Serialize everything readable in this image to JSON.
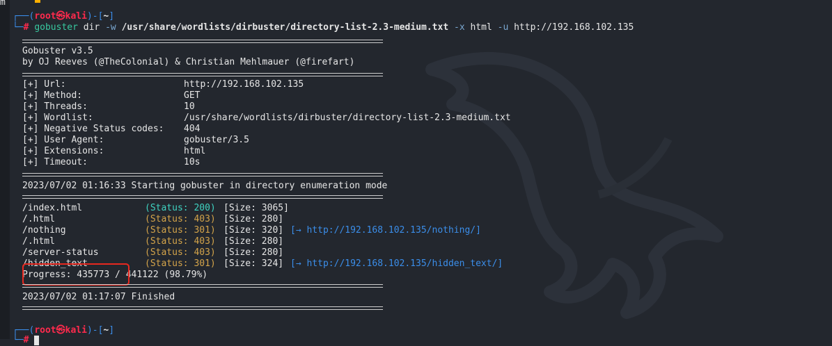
{
  "prompt": {
    "open": "┌──(",
    "user": "root㉿kali",
    "mid": ")-[",
    "dir": "~",
    "close": "]",
    "hash_prefix": "└─",
    "hash": "#"
  },
  "command": {
    "bin": "gobuster",
    "sub": "dir",
    "flag_w": "-w",
    "wordlist": "/usr/share/wordlists/dirbuster/directory-list-2.3-medium.txt",
    "flag_x": "-x",
    "ext": "html",
    "flag_u": "-u",
    "url": "http://192.168.102.135"
  },
  "banner": {
    "version": "Gobuster v3.5",
    "authors": "by OJ Reeves (@TheColonial) & Christian Mehlmauer (@firefart)"
  },
  "settings": [
    {
      "label": "[+] Url:",
      "value": "http://192.168.102.135"
    },
    {
      "label": "[+] Method:",
      "value": "GET"
    },
    {
      "label": "[+] Threads:",
      "value": "10"
    },
    {
      "label": "[+] Wordlist:",
      "value": "/usr/share/wordlists/dirbuster/directory-list-2.3-medium.txt"
    },
    {
      "label": "[+] Negative Status codes:",
      "value": "404"
    },
    {
      "label": "[+] User Agent:",
      "value": "gobuster/3.5"
    },
    {
      "label": "[+] Extensions:",
      "value": "html"
    },
    {
      "label": "[+] Timeout:",
      "value": "10s"
    }
  ],
  "start_msg": "2023/07/02 01:16:33 Starting gobuster in directory enumeration mode",
  "results": [
    {
      "path": "/index.html",
      "status": "(Status: 200)",
      "size": "[Size: 3065]",
      "redirect": ""
    },
    {
      "path": "/.html",
      "status": "(Status: 403)",
      "size": "[Size: 280]",
      "redirect": ""
    },
    {
      "path": "/nothing",
      "status": "(Status: 301)",
      "size": "[Size: 320]",
      "redirect": "[→ http://192.168.102.135/nothing/]"
    },
    {
      "path": "/.html",
      "status": "(Status: 403)",
      "size": "[Size: 280]",
      "redirect": ""
    },
    {
      "path": "/server-status",
      "status": "(Status: 403)",
      "size": "[Size: 280]",
      "redirect": ""
    },
    {
      "path": "/hidden_text",
      "status": "(Status: 301)",
      "size": "[Size: 324]",
      "redirect": "[→ http://192.168.102.135/hidden_text/]"
    }
  ],
  "progress": "Progress: 435773 / 441122 (98.79%)",
  "finish_msg": "2023/07/02 01:17:07 Finished",
  "left_edge_char": "m",
  "colors": {
    "background": "#23272e",
    "prompt_blue": "#3b8eea",
    "prompt_red": "#ff2a4d",
    "status_ok": "#3fd3c1",
    "status_other": "#d4a44a",
    "highlight": "#e8281f"
  }
}
